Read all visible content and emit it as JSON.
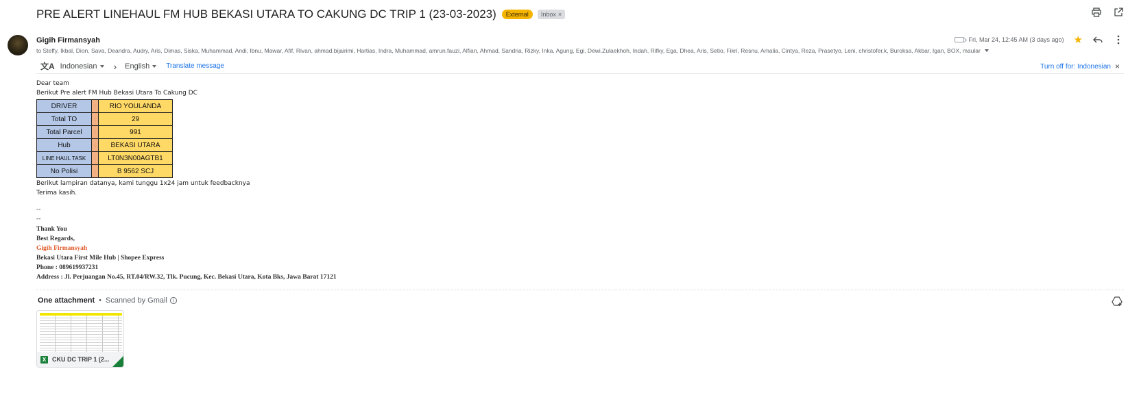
{
  "email": {
    "subject": "PRE ALERT LINEHAUL FM HUB BEKASI UTARA TO CAKUNG DC TRIP 1 (23-03-2023)",
    "labels": {
      "external": "External",
      "inbox": "Inbox",
      "remove": "×"
    },
    "sender": "Gigih Firmansyah",
    "to": "to Steffy, Ikbal, Dion, Sava, Deandra, Audry, Aris, Dimas, Siska, Muhammad, Andi, Ibnu, Mawar, Afif, Rivan, ahmad.bijairimi, Hartias, Indra, Muhammad, amrun.fauzi, Alfian, Ahmad, Sandria, Rizky, Inka, Agung, Egi, Dewi.Zulaekhoh, Indah, Rifky, Ega, Dhea, Aris, Setio, Fikri, Resnu, Amalia, Cintya, Reza, Prasetyo, Leni, christofer.k, Buroksa, Akbar, Igan, BOX, maular",
    "date": "Fri, Mar 24, 12:45 AM (3 days ago)"
  },
  "translate": {
    "from_lang": "Indonesian",
    "to_lang": "English",
    "action": "Translate message",
    "turn_off": "Turn off for: Indonesian",
    "close": "×"
  },
  "body": {
    "greeting": "Dear team",
    "intro": "Berikut Pre alert FM Hub Bekasi Utara To Cakung DC",
    "table": [
      {
        "key": "DRIVER",
        "colon": ":",
        "value": "RIO YOULANDA"
      },
      {
        "key": "Total TO",
        "colon": ":",
        "value": "29"
      },
      {
        "key": "Total Parcel",
        "colon": ":",
        "value": "991"
      },
      {
        "key": "Hub",
        "colon": ":",
        "value": "BEKASI UTARA"
      },
      {
        "key": "LINE HAUL TASK",
        "colon": ":",
        "value": "LT0N3N00AGTB1"
      },
      {
        "key": "No Polisi",
        "colon": ":",
        "value": "B 9562 SCJ"
      }
    ],
    "lampiran": "Berikut lampiran datanya, kami tunggu 1x24 jam untuk feedbacknya",
    "thanks": "Terima kasih.",
    "dash1": "--",
    "dash2": "--"
  },
  "signature": {
    "thank_you": "Thank You",
    "regards": "Best Regards,",
    "name": "Gigih Firmansyah",
    "hub": "Bekasi Utara First Mile Hub |  Shopee Express",
    "phone": "Phone : 089619937231",
    "address": "Address : Jl. Perjuangan No.45, RT.04/RW.32, Tlk. Pucung, Kec. Bekasi Utara, Kota Bks, Jawa Barat 17121"
  },
  "attachments": {
    "heading": "One attachment",
    "separator": "•",
    "scanned": "Scanned by Gmail",
    "file_name": "CKU DC TRIP 1 (2...",
    "file_type_letter": "X"
  },
  "colors": {
    "key_cell": "#b4c7e7",
    "colon_cell": "#f4b183",
    "value_cell": "#ffd966",
    "signature_name": "#e05a2b",
    "external_badge": "#f4b400",
    "link": "#1a73e8"
  }
}
